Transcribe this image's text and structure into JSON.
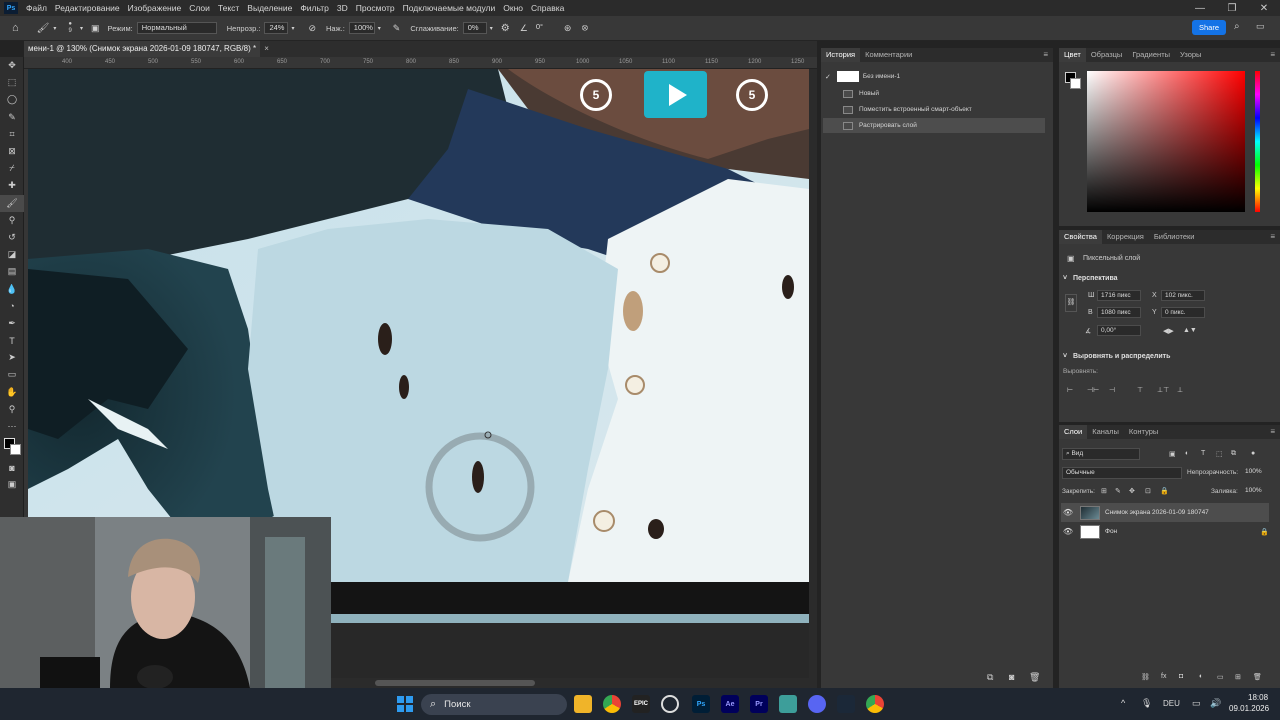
{
  "menu": {
    "app_logo": "Ps",
    "items": [
      "Файл",
      "Редактирование",
      "Изображение",
      "Слои",
      "Текст",
      "Выделение",
      "Фильтр",
      "3D",
      "Просмотр",
      "Подключаемые модули",
      "Окно",
      "Справка"
    ]
  },
  "options": {
    "brush_size": "9",
    "mode_label": "Режим:",
    "mode_value": "Нормальный",
    "opacity_label": "Непрозр.:",
    "opacity_value": "24%",
    "flow_label": "Наж.:",
    "flow_value": "100%",
    "smoothing_label": "Сглаживание:",
    "smoothing_value": "0%",
    "angle_value": "0°",
    "share_label": "Share"
  },
  "document": {
    "tab_title": "мени-1 @ 130% (Снимок экрана 2026-01-09 180747, RGB/8) *",
    "close_glyph": "×"
  },
  "rulers": {
    "h_ticks": [
      "400",
      "450",
      "500",
      "550",
      "600",
      "650",
      "700",
      "750",
      "800",
      "850",
      "900",
      "950",
      "1000",
      "1050",
      "1100",
      "1150",
      "1200",
      "1250"
    ]
  },
  "video_overlay": {
    "rewind_label": "5",
    "forward_label": "5",
    "play_color": "#1fb3c9"
  },
  "history_panel": {
    "tabs": [
      "История",
      "Комментарии"
    ],
    "snapshot_label": "Без имени-1",
    "steps": [
      "Новый",
      "Поместить встроенный смарт-объект",
      "Растрировать слой"
    ]
  },
  "color_panel": {
    "tabs": [
      "Цвет",
      "Образцы",
      "Градиенты",
      "Узоры"
    ]
  },
  "properties_panel": {
    "tabs": [
      "Свойства",
      "Коррекция",
      "Библиотеки"
    ],
    "layer_type": "Пиксельный слой",
    "section_transform": "Перспектива",
    "w_label": "Ш",
    "w_value": "1716 пикс",
    "h_label": "В",
    "h_value": "1080 пикс",
    "x_label": "X",
    "x_value": "102 пикс.",
    "y_label": "Y",
    "y_value": "0 пикс.",
    "angle_value": "0,00°",
    "section_align": "Выровнять и распределить",
    "align_label": "Выровнять:"
  },
  "layers_panel": {
    "tabs": [
      "Слои",
      "Каналы",
      "Контуры"
    ],
    "filter_value": "Вид",
    "blend_mode": "Обычные",
    "opacity_label": "Непрозрачность:",
    "opacity_value": "100%",
    "lock_label": "Закрепить:",
    "fill_label": "Заливка:",
    "fill_value": "100%",
    "layers": [
      {
        "name": "Снимок экрана 2026-01-09 180747",
        "selected": true
      },
      {
        "name": "Фон",
        "selected": false
      }
    ]
  },
  "taskbar": {
    "search_placeholder": "Поиск",
    "apps": [
      "Ps",
      "Ae",
      "Pr"
    ],
    "lang": "DEU",
    "time": "18:08",
    "date": "09.01.2026"
  }
}
